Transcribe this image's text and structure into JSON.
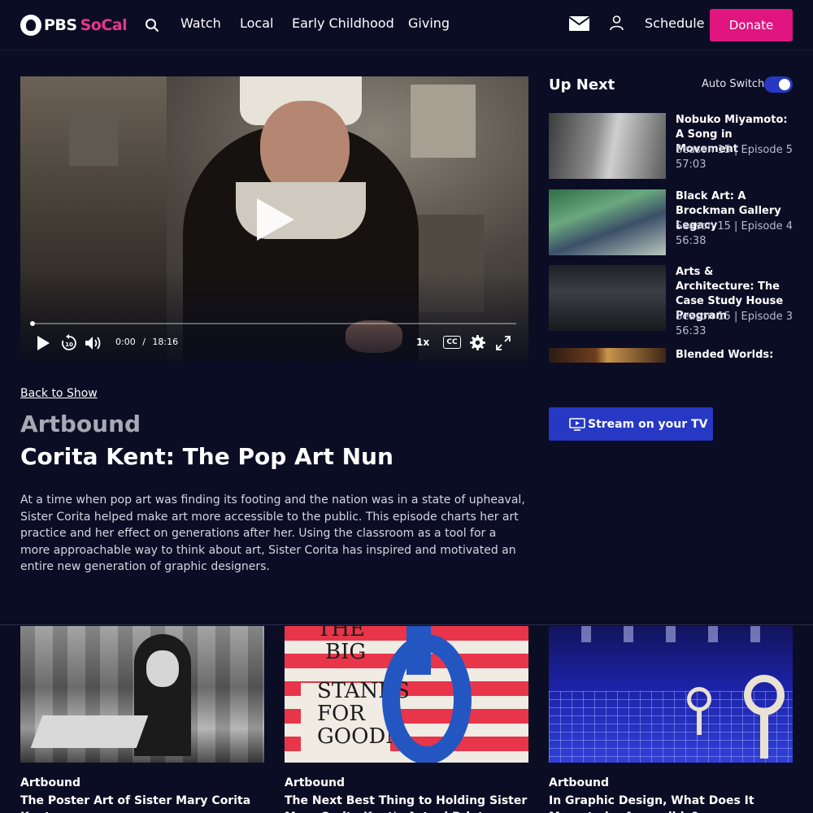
{
  "header": {
    "logo_pbs": "PBS",
    "logo_socal": "SoCal",
    "nav": [
      "Watch",
      "Local",
      "Early Childhood",
      "Giving"
    ],
    "schedule": "Schedule",
    "donate": "Donate"
  },
  "player": {
    "current_time": "0:00",
    "separator": "/",
    "duration": "18:16",
    "speed": "1x",
    "cc": "CC",
    "progress": 0
  },
  "up_next": {
    "title": "Up Next",
    "auto_switch_label": "Auto Switch",
    "auto_switch_on": true,
    "episodes": [
      {
        "title": "Nobuko Miyamoto: A Song in Movement",
        "season": "Season 15",
        "episode": "Episode 5",
        "duration": "57:03"
      },
      {
        "title": "Black Art: A Brockman Gallery Legacy",
        "season": "Season 15",
        "episode": "Episode 4",
        "duration": "56:38"
      },
      {
        "title": "Arts & Architecture: The Case Study House Program",
        "season": "Season 15",
        "episode": "Episode 3",
        "duration": "56:33"
      },
      {
        "title": "Blended Worlds: The"
      }
    ]
  },
  "stream_button": "Stream on your TV",
  "info": {
    "back_link": "Back to Show",
    "show": "Artbound",
    "episode_title": "Corita Kent: The Pop Art Nun",
    "description": "At a time when pop art was finding its footing and the nation was in a state of upheaval, Sister Corita helped make art more accessible to the public. This episode charts her art practice and her effect on generations after her. Using the classroom as a tool for a more approachable way to think about art, Sister Corita has inspired and motivated an entire new generation of graphic designers."
  },
  "related": [
    {
      "show": "Artbound",
      "title": "The Poster Art of Sister Mary Corita Kent"
    },
    {
      "show": "Artbound",
      "title": "The Next Best Thing to Holding Sister Mary Corita Kent's Actual Print",
      "art_text": [
        "THE",
        "BIG",
        "STANDS",
        "FOR",
        "GOODN"
      ]
    },
    {
      "show": "Artbound",
      "title": "In Graphic Design, What Does It Mean to be Accessible?"
    }
  ],
  "colors": {
    "background": "#0b0d24",
    "donate": "#e0157f",
    "accent": "#2638c4",
    "brand_pink": "#e8358f"
  }
}
